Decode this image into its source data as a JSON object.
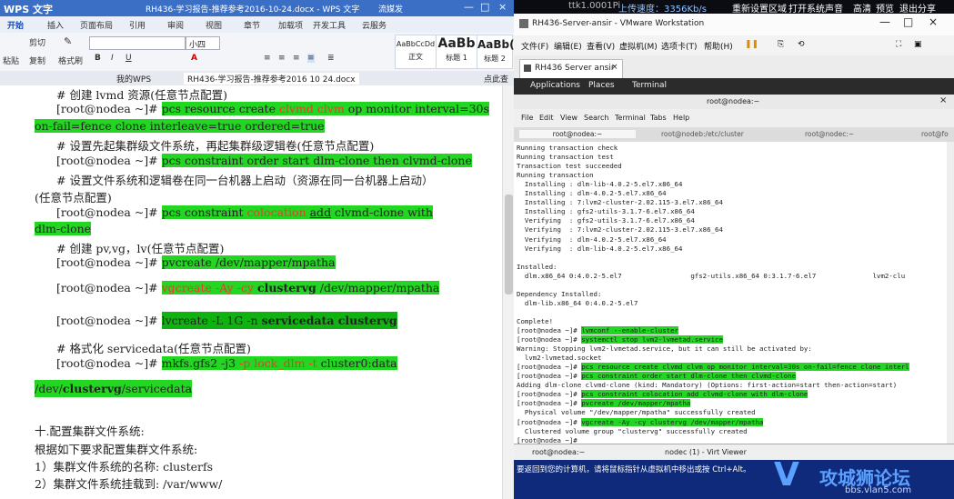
{
  "topstrip": {
    "items": [
      "ttk1.0001Pi",
      "上传速度：3356Kb/s",
      "重新设置区域",
      "打开系统声音",
      "高清",
      "预览",
      "退出分享"
    ]
  },
  "wps": {
    "app_title": "WPS 文字",
    "doc_title": "RH436-学习报告-推荐参考2016-10-24.docx - WPS 文字",
    "title_extra": "流媒发",
    "menu": [
      "开始",
      "插入",
      "页面布局",
      "引用",
      "审阅",
      "视图",
      "章节",
      "加载项",
      "开发工具",
      "云服务"
    ],
    "ribbon": {
      "cut": "剪切",
      "paste": "粘贴",
      "copy": "复制",
      "format_painter": "格式刷",
      "font_size": "小四",
      "styles": [
        {
          "sample": "AaBbCcDd",
          "name": "正文"
        },
        {
          "sample": "AaBb",
          "name": "标题 1"
        },
        {
          "sample": "AaBb(",
          "name": "标题 2"
        }
      ]
    },
    "tabs": [
      "我的WPS",
      "RH436-学习报告-推荐参考2016 10 24.docx",
      "点此查"
    ],
    "doc_lines": {
      "l1": "# 创建 lvmd 资源(任意节点配置)",
      "l2_prompt": "[root@nodea ~]# ",
      "l2a": "pcs resource create ",
      "l2b": "clvmd clvm",
      "l2c": " op monitor interval=30s",
      "l3": "on-fail=fence clone interleave=true ordered=true",
      "l4": "# 设置先起集群级文件系统，再起集群级逻辑卷(任意节点配置)",
      "l5_prompt": "[root@nodea ~]# ",
      "l5": "pcs constraint order start dlm-clone then clvmd-clone",
      "l6": "# 设置文件系统和逻辑卷在同一台机器上启动（资源在同一台机器上启动）",
      "l7": "(任意节点配置)",
      "l8_prompt": "[root@nodea ~]# ",
      "l8a": "pcs  constraint  ",
      "l8b": "colocation",
      "l8c": "  ",
      "l8d": "add",
      "l8e": "  clvmd-clone  with",
      "l9": "dlm-clone",
      "l10": "# 创建 pv,vg，lv(任意节点配置)",
      "l11_prompt": "[root@nodea ~]# ",
      "l11": "pvcreate /dev/mapper/mpatha",
      "l12_prompt": "[root@nodea ~]# ",
      "l12a": "vgcreate -Ay -cy ",
      "l12b": "clustervg",
      "l12c": " /dev/mapper/mpatha",
      "l13_prompt": "[root@nodea ~]# ",
      "l13a": "lvcreate -L 1G -n ",
      "l13b": "servicedata clustervg",
      "l14": "# 格式化 servicedata(任意节点配置)",
      "l15_prompt": "[root@nodea ~]# ",
      "l15a": "mkfs.gfs2  -j3  ",
      "l15b": "-p  lock_dlm  -t",
      "l15c": "  cluster0:data",
      "l16a": "/dev/",
      "l16b": "clustervg",
      "l16c": "/servicedata",
      "l17": "十.配置集群文件系统:",
      "l18": "根据如下要求配置集群文件系统:",
      "l19": "1）集群文件系统的名称: clusterfs",
      "l20": "2）集群文件系统挂载到: /var/www/"
    }
  },
  "vmware": {
    "title": "RH436-Server-ansir - VMware Workstation",
    "menu": [
      "文件(F)",
      "编辑(E)",
      "查看(V)",
      "虚拟机(M)",
      "选项卡(T)",
      "帮助(H)"
    ],
    "tab": "RH436 Server ansir",
    "gnome": {
      "applications": "Applications",
      "places": "Places",
      "terminal": "Terminal"
    },
    "terminal_title": "root@nodea:~",
    "terminal_menu": [
      "File",
      "Edit",
      "View",
      "Search",
      "Terminal",
      "Tabs",
      "Help"
    ],
    "terminal_tabs": [
      "root@nodea:~",
      "root@nodeb:/etc/cluster",
      "root@nodec:~",
      "root@nodea:~",
      "root@nodea:~",
      "root@fo"
    ],
    "term_lines": [
      "Running transaction check",
      "Running transaction test",
      "Transaction test succeeded",
      "Running transaction",
      "  Installing : dlm-lib-4.0.2-5.el7.x86_64",
      "  Installing : dlm-4.0.2-5.el7.x86_64",
      "  Installing : 7:lvm2-cluster-2.02.115-3.el7.x86_64",
      "  Installing : gfs2-utils-3.1.7-6.el7.x86_64",
      "  Verifying  : gfs2-utils-3.1.7-6.el7.x86_64",
      "  Verifying  : 7:lvm2-cluster-2.02.115-3.el7.x86_64",
      "  Verifying  : dlm-4.0.2-5.el7.x86_64",
      "  Verifying  : dlm-lib-4.0.2-5.el7.x86_64",
      "",
      "Installed:",
      "  dlm.x86_64 0:4.0.2-5.el7                 gfs2-utils.x86_64 0:3.1.7-6.el7              lvm2-clu",
      "",
      "Dependency Installed:",
      "  dlm-lib.x86_64 0:4.0.2-5.el7",
      "",
      "Complete!",
      "[root@nodea ~]# lvmconf --enable-cluster",
      "[root@nodea ~]# systemctl stop lvm2-lvmetad.service",
      "Warning: Stopping lvm2-lvmetad.service, but it can still be activated by:",
      "  lvm2-lvmetad.socket",
      "[root@nodea ~]# pcs resource create clvmd clvm op monitor interval=30s on-fail=fence clone interl",
      "[root@nodea ~]# pcs constraint order start dlm-clone then clvmd-clone",
      "Adding dlm-clone clvmd-clone (kind: Mandatory) (Options: first-action=start then-action=start)",
      "[root@nodea ~]# pcs constraint colocation add clvmd-clone with dlm-clone",
      "[root@nodea ~]# pvcreate /dev/mapper/mpatha",
      "  Physical volume \"/dev/mapper/mpatha\" successfully created",
      "[root@nodea ~]# vgcreate -Ay -cy clustervg /dev/mapper/mpatha",
      "  Clustered volume group \"clustervg\" successfully created",
      "[root@nodea ~]# "
    ],
    "taskbar": [
      "root@nodea:~",
      "nodec (1) - Virt Viewer"
    ],
    "status_hint": "要返回到您的计算机，请将鼠标指针从虚拟机中移出或按 Ctrl+Alt。",
    "watermark": {
      "title": "攻城狮论坛",
      "url": "bbs.vlan5.com"
    }
  }
}
